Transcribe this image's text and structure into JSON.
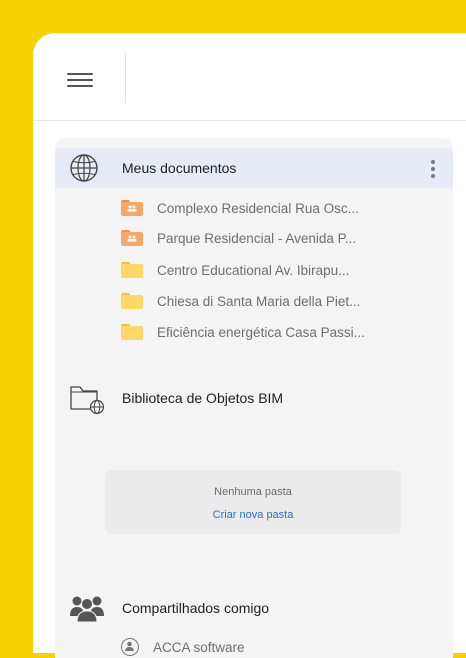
{
  "header": {
    "menu_icon": "hamburger-menu-icon"
  },
  "my_documents": {
    "label": "Meus documentos",
    "icon": "globe-icon",
    "more_icon": "more-vertical-icon",
    "items": [
      {
        "label": "Complexo Residencial Rua Osc...",
        "icon": "shared-folder-icon",
        "shared": true
      },
      {
        "label": "Parque Residencial - Avenida P...",
        "icon": "shared-folder-icon",
        "shared": true
      },
      {
        "label": "Centro Educational Av. Ibirapu...",
        "icon": "folder-icon",
        "shared": false
      },
      {
        "label": "Chiesa di Santa Maria della Piet...",
        "icon": "folder-icon",
        "shared": false
      },
      {
        "label": "Eficiência energética Casa Passi...",
        "icon": "folder-icon",
        "shared": false
      }
    ]
  },
  "bim_library": {
    "label": "Biblioteca de Objetos BIM",
    "icon": "folder-globe-icon",
    "empty_text": "Nenhuma pasta",
    "create_link": "Criar nova pasta"
  },
  "shared_with_me": {
    "label": "Compartilhados comigo",
    "icon": "users-group-icon",
    "items": [
      {
        "label": "ACCA software",
        "icon": "user-circle-icon"
      }
    ]
  },
  "colors": {
    "background": "#f7d100",
    "selected_row": "#e6ebf6",
    "folder": "#ffd766",
    "shared_folder": "#f7a868",
    "link": "#2a6fd3"
  }
}
